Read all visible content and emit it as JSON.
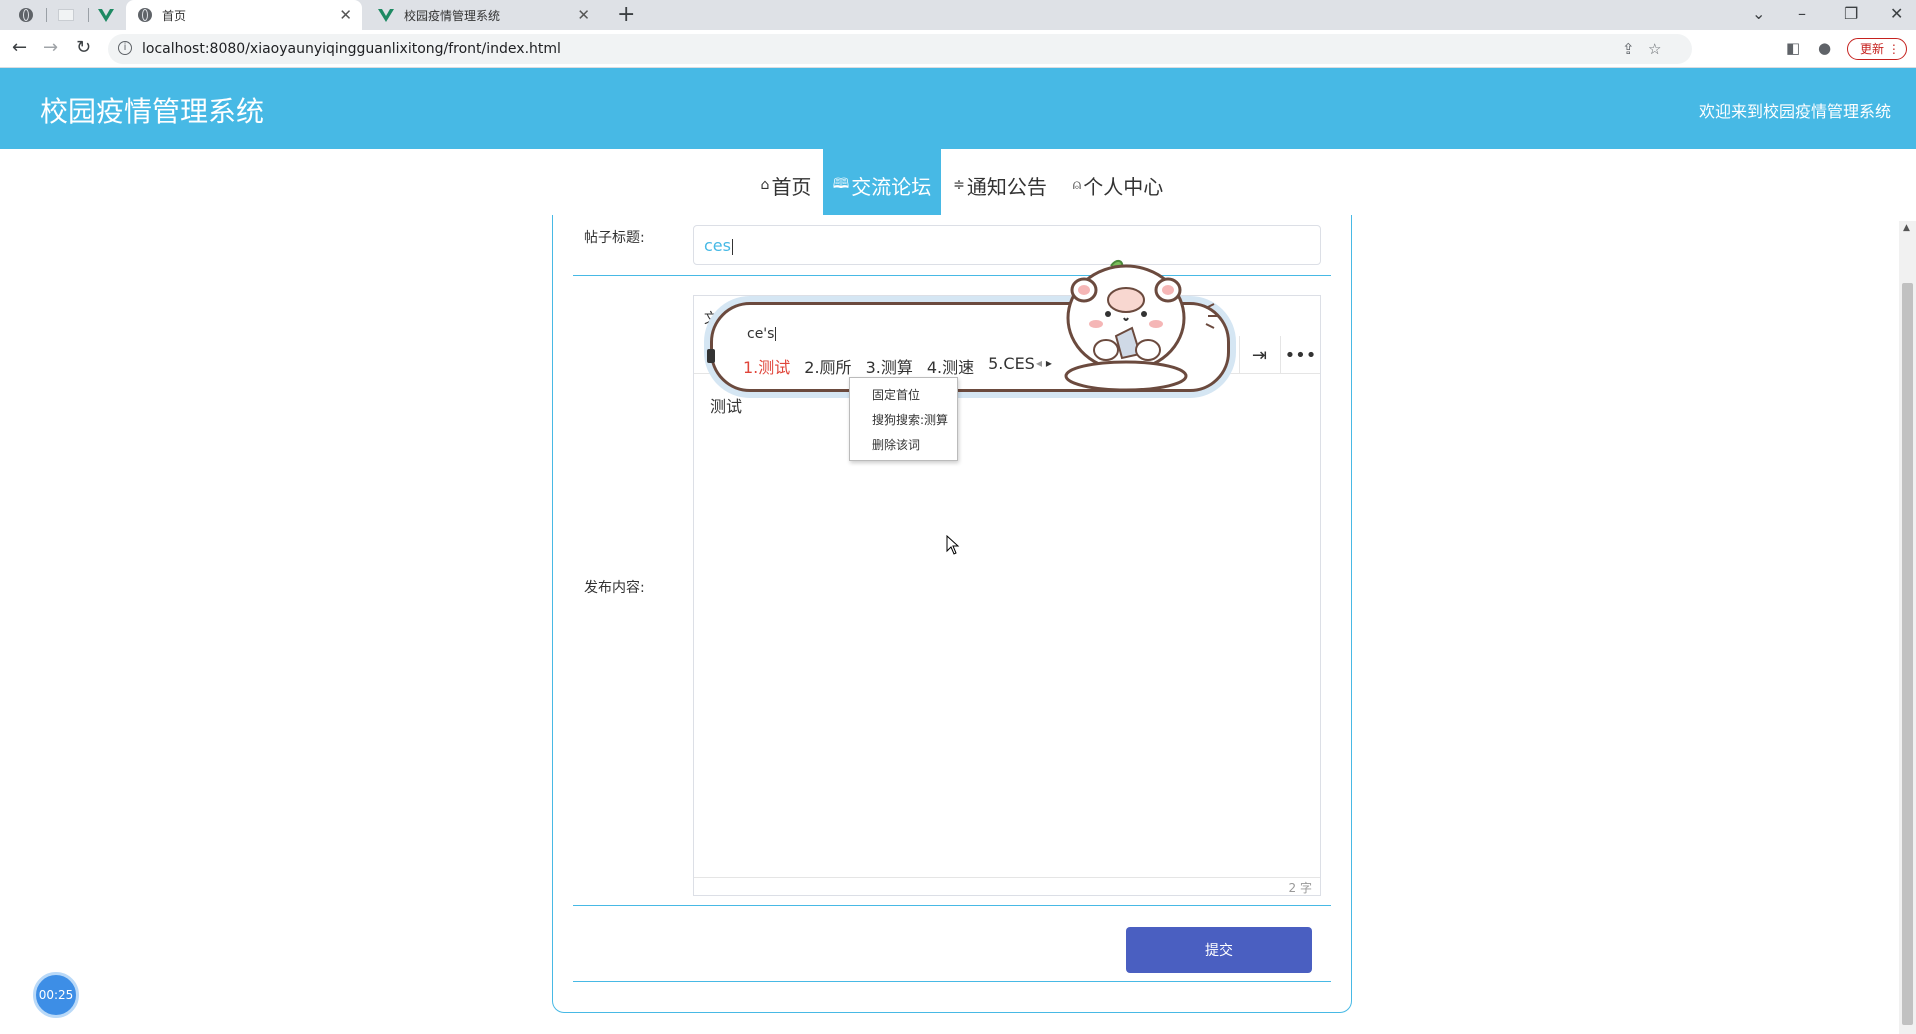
{
  "browser": {
    "tabs": [
      {
        "title": "首页",
        "active": true
      },
      {
        "title": "校园疫情管理系统",
        "active": false
      }
    ],
    "url": "localhost:8080/xiaoyaunyiqingguanlixitong/front/index.html",
    "update_label": "更新"
  },
  "site": {
    "title": "校园疫情管理系统",
    "welcome": "欢迎来到校园疫情管理系统",
    "nav": [
      {
        "label": "首页",
        "icon": "home-icon"
      },
      {
        "label": "交流论坛",
        "icon": "forum-icon",
        "active": true
      },
      {
        "label": "通知公告",
        "icon": "notice-icon"
      },
      {
        "label": "个人中心",
        "icon": "user-icon"
      }
    ],
    "accent_color": "#47b9e5"
  },
  "form": {
    "title_label": "帖子标题:",
    "title_value": "ces",
    "content_label": "发布内容:",
    "editor_toolbar_partial": "文",
    "editor_content": "测试",
    "word_count": "2 字",
    "submit_label": "提交"
  },
  "ime": {
    "composition": "ce's",
    "candidates": [
      "1.测试",
      "2.厕所",
      "3.测算",
      "4.测速",
      "5.CES"
    ],
    "context_menu": [
      "固定首位",
      "搜狗搜索:测算",
      "删除该词"
    ]
  },
  "timer": "00:25"
}
